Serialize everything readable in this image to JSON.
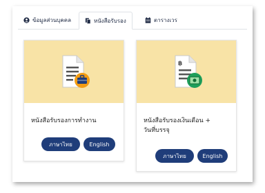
{
  "tabs": [
    {
      "label": "ข้อมูลส่วนบุคคล",
      "icon": "user-circle-icon",
      "active": false
    },
    {
      "label": "หนังสือรับรอง",
      "icon": "documents-icon",
      "active": true
    },
    {
      "label": "ตารางเวร",
      "icon": "calendar-icon",
      "active": false
    }
  ],
  "cards": [
    {
      "title": "หนังสือรับรองการทำงาน",
      "icon": "document-with-briefcase-icon",
      "buttons": {
        "thai": "ภาษาไทย",
        "english": "English"
      }
    },
    {
      "title_line1": "หนังสือรับรองเงินเดือน +",
      "title_line2": "วันที่บรรจุ",
      "icon": "document-with-money-icon",
      "doc_symbol": "฿",
      "buttons": {
        "thai": "ภาษาไทย",
        "english": "English"
      }
    }
  ],
  "colors": {
    "card_header_bg": "#f8e3a6",
    "button_bg": "#1f3d7a",
    "badge_orange": "#f39c12",
    "badge_green": "#1e9e5a"
  }
}
